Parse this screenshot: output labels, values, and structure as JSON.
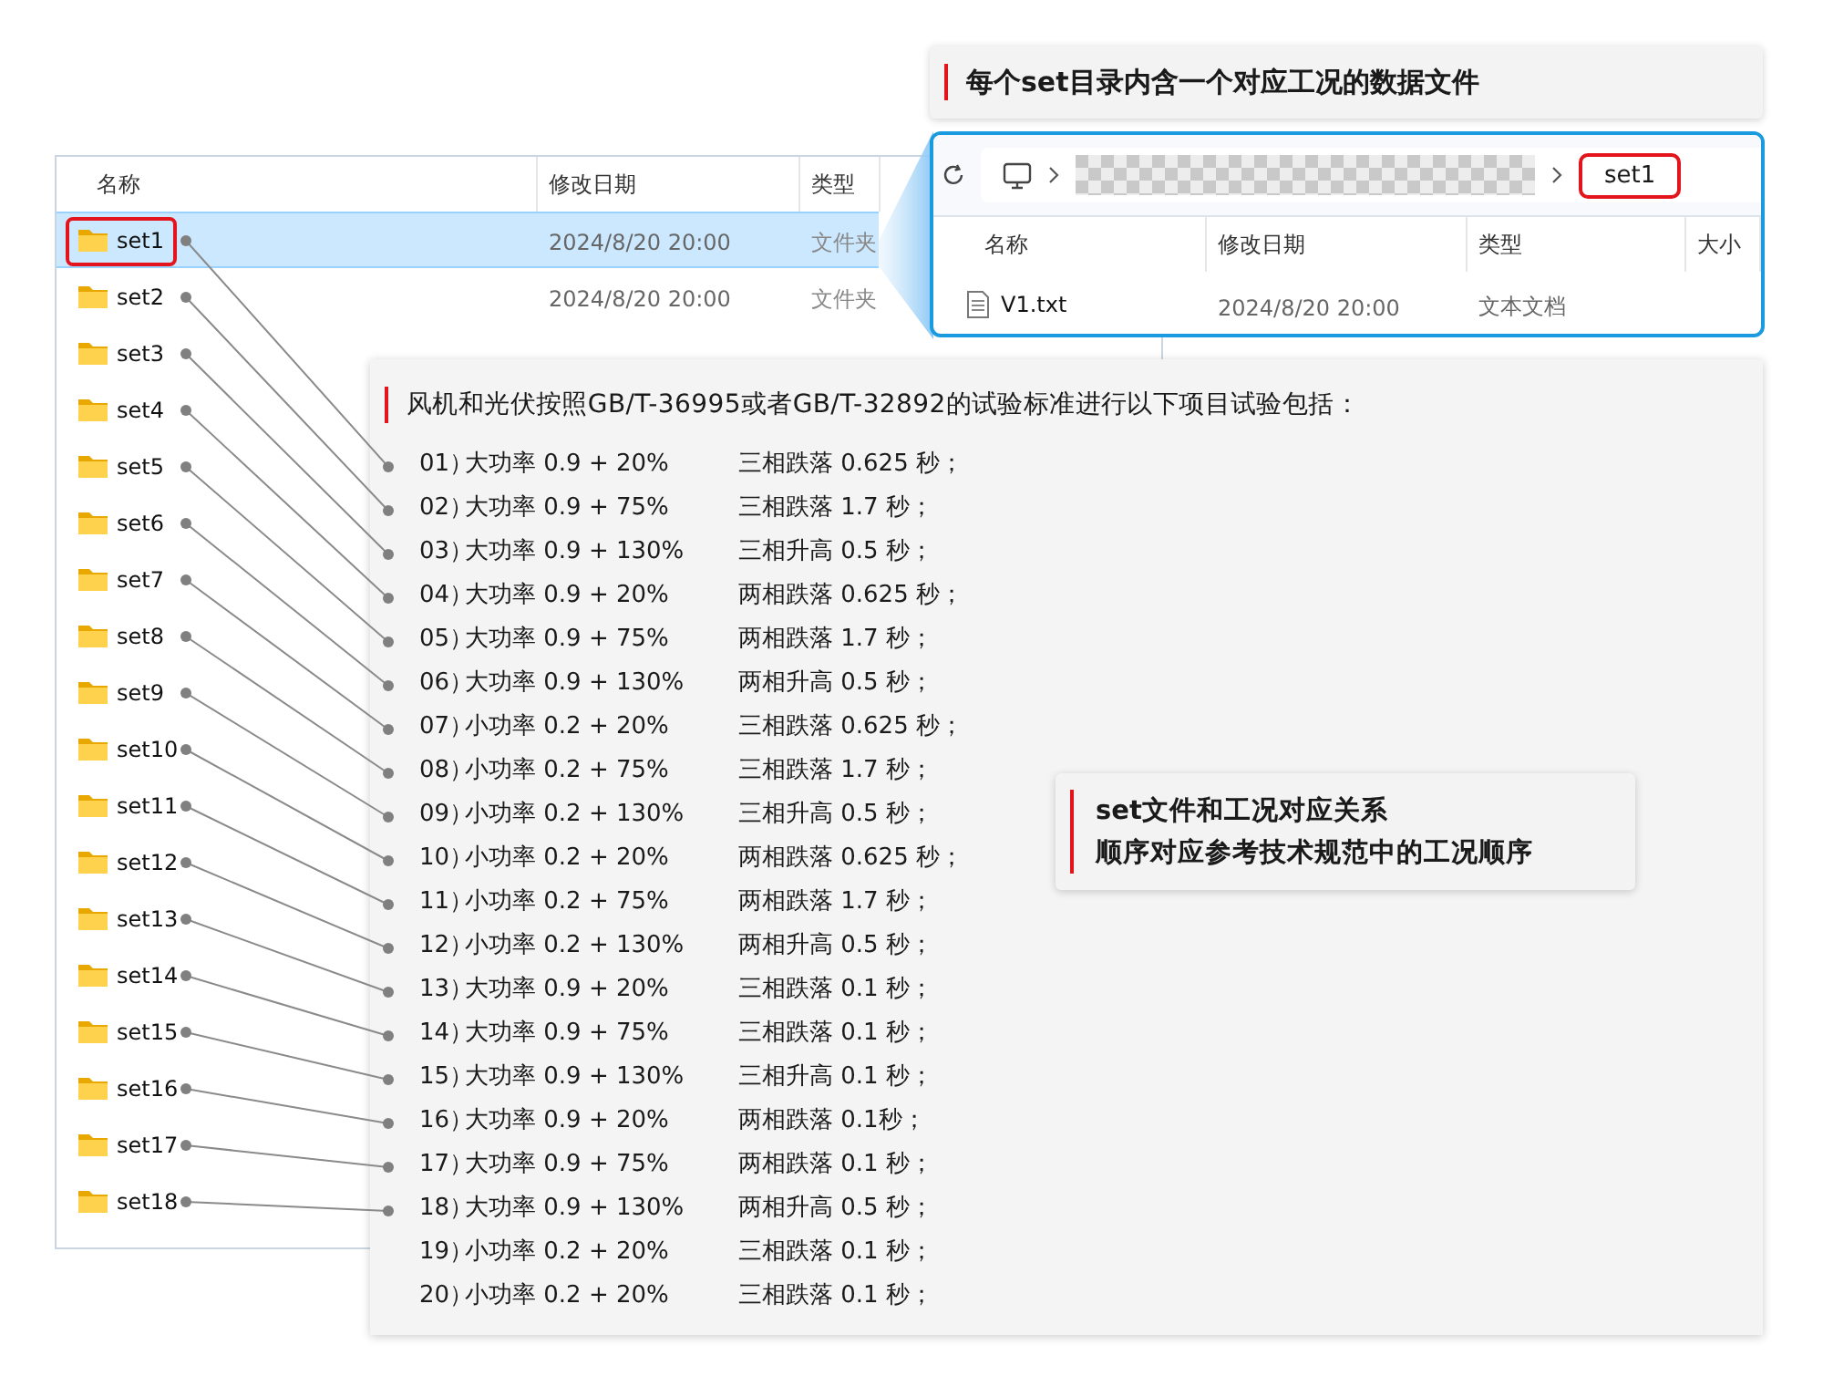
{
  "left_explorer": {
    "columns": [
      "名称",
      "修改日期",
      "类型"
    ],
    "rows": [
      {
        "name": "set1",
        "date": "2024/8/20 20:00",
        "type": "文件夹",
        "selected": true,
        "marked": true
      },
      {
        "name": "set2",
        "date": "2024/8/20 20:00",
        "type": "文件夹",
        "selected": false,
        "marked": false
      },
      {
        "name": "set3",
        "selected": false,
        "marked": false
      },
      {
        "name": "set4",
        "selected": false,
        "marked": false
      },
      {
        "name": "set5",
        "selected": false,
        "marked": false
      },
      {
        "name": "set6",
        "selected": false,
        "marked": false
      },
      {
        "name": "set7",
        "selected": false,
        "marked": false
      },
      {
        "name": "set8",
        "selected": false,
        "marked": false
      },
      {
        "name": "set9",
        "selected": false,
        "marked": false
      },
      {
        "name": "set10",
        "selected": false,
        "marked": false
      },
      {
        "name": "set11",
        "selected": false,
        "marked": false
      },
      {
        "name": "set12",
        "selected": false,
        "marked": false
      },
      {
        "name": "set13",
        "selected": false,
        "marked": false
      },
      {
        "name": "set14",
        "selected": false,
        "marked": false
      },
      {
        "name": "set15",
        "selected": false,
        "marked": false
      },
      {
        "name": "set16",
        "selected": false,
        "marked": false
      },
      {
        "name": "set17",
        "selected": false,
        "marked": false
      },
      {
        "name": "set18",
        "selected": false,
        "marked": false
      }
    ]
  },
  "top_note": "每个set目录内含一个对应工况的数据文件",
  "right_explorer": {
    "address_current": {
      "label": "set1",
      "marked": true
    },
    "columns": [
      "名称",
      "修改日期",
      "类型",
      "大小"
    ],
    "rows": [
      {
        "name": "V1.txt",
        "date": "2024/8/20 20:00",
        "type": "文本文档"
      }
    ]
  },
  "test_panel": {
    "title": "风机和光伏按照GB/T-36995或者GB/T-32892的试验标准进行以下项目试验包括：",
    "items": [
      {
        "no": "01）",
        "condition": "大功率 0.9 + 20%",
        "test": "三相跌落 0.625 秒；"
      },
      {
        "no": "02）",
        "condition": "大功率 0.9 + 75%",
        "test": "三相跌落 1.7 秒；"
      },
      {
        "no": "03）",
        "condition": "大功率 0.9 + 130%",
        "test": "三相升高 0.5 秒；"
      },
      {
        "no": "04）",
        "condition": "大功率 0.9 + 20%",
        "test": "两相跌落 0.625 秒；"
      },
      {
        "no": "05）",
        "condition": "大功率 0.9 + 75%",
        "test": "两相跌落 1.7 秒；"
      },
      {
        "no": "06）",
        "condition": "大功率 0.9 + 130%",
        "test": "两相升高 0.5 秒；"
      },
      {
        "no": "07）",
        "condition": "小功率 0.2 + 20%",
        "test": "三相跌落 0.625 秒；"
      },
      {
        "no": "08）",
        "condition": "小功率 0.2 + 75%",
        "test": "三相跌落 1.7 秒；"
      },
      {
        "no": "09）",
        "condition": "小功率 0.2 + 130%",
        "test": "三相升高 0.5 秒；"
      },
      {
        "no": "10）",
        "condition": "小功率 0.2 + 20%",
        "test": "两相跌落 0.625 秒；"
      },
      {
        "no": "11）",
        "condition": "小功率 0.2 + 75%",
        "test": "两相跌落 1.7 秒；"
      },
      {
        "no": "12）",
        "condition": "小功率 0.2 + 130%",
        "test": "两相升高 0.5 秒；"
      },
      {
        "no": "13）",
        "condition": "大功率 0.9 + 20%",
        "test": "三相跌落 0.1 秒；"
      },
      {
        "no": "14）",
        "condition": "大功率 0.9 + 75%",
        "test": "三相跌落 0.1 秒；"
      },
      {
        "no": "15）",
        "condition": "大功率 0.9 + 130%",
        "test": "三相升高 0.1 秒；"
      },
      {
        "no": "16）",
        "condition": "大功率 0.9 + 20%",
        "test": "两相跌落 0.1秒；"
      },
      {
        "no": "17）",
        "condition": "大功率 0.9 + 75%",
        "test": "两相跌落 0.1 秒；"
      },
      {
        "no": "18）",
        "condition": "大功率 0.9 + 130%",
        "test": "两相升高 0.5 秒；"
      },
      {
        "no": "19）",
        "condition": "小功率 0.2 + 20%",
        "test": "三相跌落 0.1 秒；"
      },
      {
        "no": "20）",
        "condition": "小功率 0.2 + 20%",
        "test": "三相跌落 0.1 秒；"
      }
    ],
    "callout": [
      "set文件和工况对应关系",
      "顺序对应参考技术规范中的工况顺序"
    ]
  }
}
